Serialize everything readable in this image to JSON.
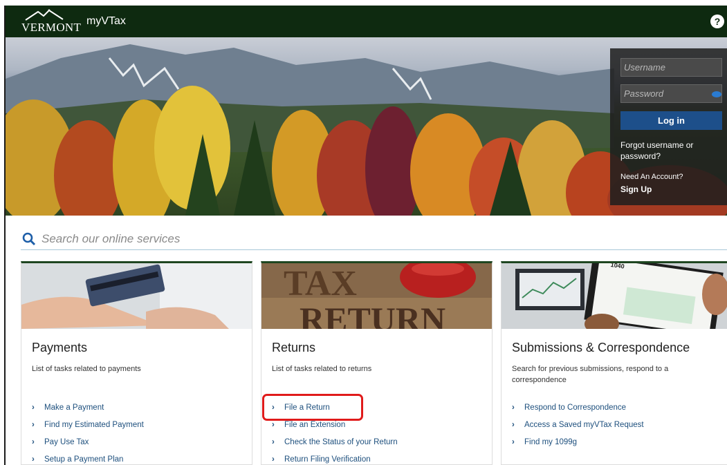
{
  "header": {
    "logo_text": "VERMONT",
    "app_title": "myVTax",
    "help_label": "?"
  },
  "login": {
    "username_placeholder": "Username",
    "password_placeholder": "Password",
    "login_label": "Log in",
    "forgot_text": "Forgot username or password?",
    "need_account": "Need An Account?",
    "signup_label": "Sign Up"
  },
  "search": {
    "placeholder": "Search our online services"
  },
  "cards": [
    {
      "title": "Payments",
      "description": "List of tasks related to payments",
      "links": [
        "Make a Payment",
        "Find my Estimated Payment",
        "Pay Use Tax",
        "Setup a Payment Plan"
      ]
    },
    {
      "title": "Returns",
      "description": "List of tasks related to returns",
      "image_text_1": "TAX",
      "image_text_2": "RETURN",
      "links": [
        "File a Return",
        "File an Extension",
        "Check the Status of your Return",
        "Return Filing Verification"
      ]
    },
    {
      "title": "Submissions & Correspondence",
      "description": "Search for previous submissions, respond to a correspondence",
      "image_text": "1040",
      "links": [
        "Respond to Correspondence",
        "Access a Saved myVTax Request",
        "Find my 1099g"
      ]
    }
  ],
  "colors": {
    "header_bg": "#0e2a10",
    "link": "#1d4f7d",
    "login_button": "#1d4f8a",
    "highlight": "#e01b1b"
  }
}
